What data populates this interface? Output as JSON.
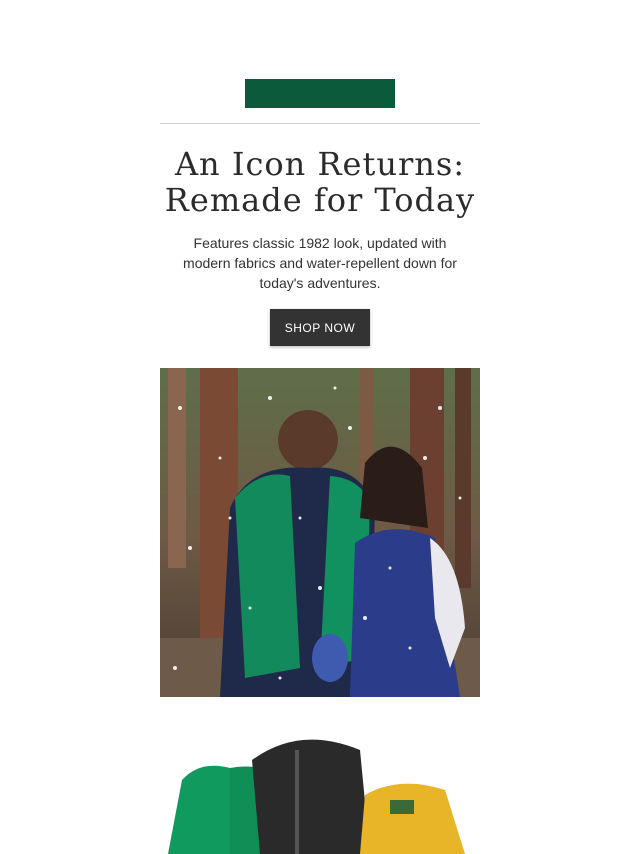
{
  "email": {
    "headline_line1": "An Icon Returns:",
    "headline_line2": "Remade for Today",
    "subcopy": "Features classic 1982 look, updated with modern fabrics and water-repellent down for today's adventures.",
    "cta_label": "SHOP NOW"
  },
  "colors": {
    "brand_green": "#0b5a3c",
    "cta_background": "#333333",
    "divider": "#d0d0d0",
    "headline": "#2b2b2b"
  }
}
